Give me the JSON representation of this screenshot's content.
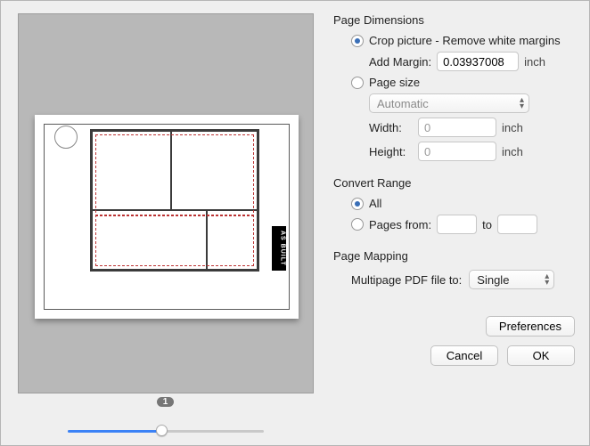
{
  "preview": {
    "page_badge": "1",
    "as_built_label": "AS BUILT",
    "zoom_percent": 48
  },
  "page_dimensions": {
    "title": "Page Dimensions",
    "crop": {
      "label": "Crop picture - Remove white margins",
      "checked": true,
      "add_margin_label": "Add Margin:",
      "add_margin_value": "0.03937008",
      "unit": "inch"
    },
    "page_size": {
      "label": "Page size",
      "checked": false,
      "select_value": "Automatic",
      "width_label": "Width:",
      "width_value": "0",
      "height_label": "Height:",
      "height_value": "0",
      "unit": "inch"
    }
  },
  "convert_range": {
    "title": "Convert Range",
    "all": {
      "label": "All",
      "checked": true
    },
    "pages": {
      "label": "Pages from:",
      "checked": false,
      "from_value": "",
      "to_label": "to",
      "to_value": ""
    }
  },
  "page_mapping": {
    "title": "Page Mapping",
    "label": "Multipage PDF file to:",
    "value": "Single"
  },
  "buttons": {
    "preferences": "Preferences",
    "cancel": "Cancel",
    "ok": "OK"
  }
}
